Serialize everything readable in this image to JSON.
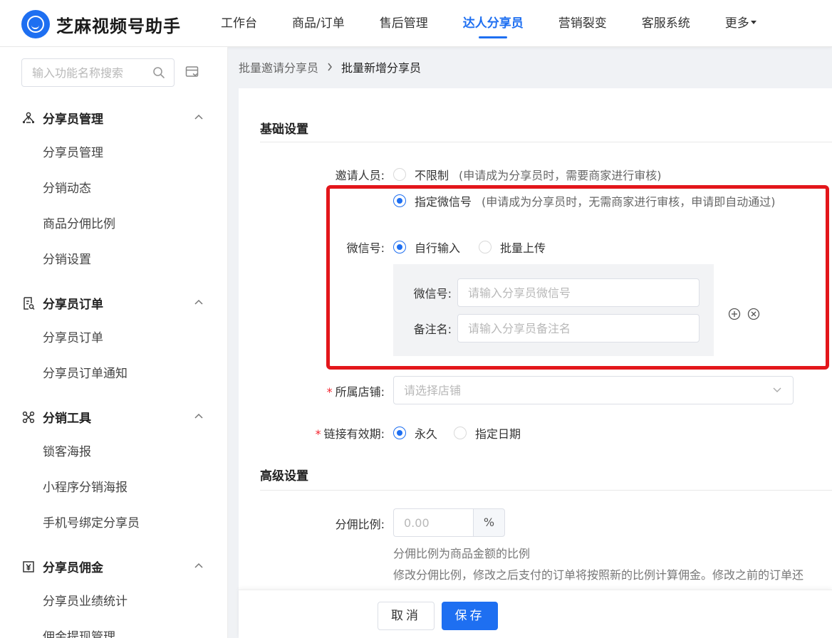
{
  "app": {
    "title": "芝麻视频号助手"
  },
  "nav": {
    "items": [
      {
        "label": "工作台",
        "active": false
      },
      {
        "label": "商品/订单",
        "active": false
      },
      {
        "label": "售后管理",
        "active": false
      },
      {
        "label": "达人分享员",
        "active": true
      },
      {
        "label": "营销裂变",
        "active": false
      },
      {
        "label": "客服系统",
        "active": false
      },
      {
        "label": "更多",
        "active": false
      }
    ]
  },
  "sidebar": {
    "search": {
      "placeholder": "输入功能名称搜索"
    },
    "groups": [
      {
        "title": "分享员管理",
        "icon": "user-network-icon",
        "items": [
          "分享员管理",
          "分销动态",
          "商品分佣比例",
          "分销设置"
        ]
      },
      {
        "title": "分享员订单",
        "icon": "order-doc-icon",
        "items": [
          "分享员订单",
          "分享员订单通知"
        ]
      },
      {
        "title": "分销工具",
        "icon": "distribution-tool-icon",
        "items": [
          "锁客海报",
          "小程序分销海报",
          "手机号绑定分享员"
        ]
      },
      {
        "title": "分享员佣金",
        "icon": "commission-icon",
        "items": [
          "分享员业绩统计",
          "佣金提现管理"
        ]
      }
    ]
  },
  "breadcrumb": {
    "parent": "批量邀请分享员",
    "current": "批量新增分享员"
  },
  "form": {
    "basic": {
      "title": "基础设置",
      "invite": {
        "label": "邀请人员:",
        "options": [
          {
            "label": "不限制",
            "hint": "(申请成为分享员时，需要商家进行审核)",
            "checked": false
          },
          {
            "label": "指定微信号",
            "hint": "(申请成为分享员时，无需商家进行审核，申请即自动通过)",
            "checked": true
          }
        ]
      },
      "wechat": {
        "label": "微信号:",
        "options": [
          {
            "label": "自行输入",
            "checked": true
          },
          {
            "label": "批量上传",
            "checked": false
          }
        ],
        "id_label": "微信号:",
        "id_placeholder": "请输入分享员微信号",
        "remark_label": "备注名:",
        "remark_placeholder": "请输入分享员备注名"
      },
      "store": {
        "label": "所属店铺:",
        "placeholder": "请选择店铺"
      },
      "validity": {
        "label": "链接有效期:",
        "options": [
          {
            "label": "永久",
            "checked": true
          },
          {
            "label": "指定日期",
            "checked": false
          }
        ]
      }
    },
    "advanced": {
      "title": "高级设置",
      "ratio": {
        "label": "分佣比例:",
        "placeholder": "0.00",
        "unit": "%",
        "note1": "分佣比例为商品金额的比例",
        "note2": "修改分佣比例，修改之后支付的订单将按照新的比例计算佣金。修改之前的订单还"
      }
    }
  },
  "footer": {
    "cancel_label": "取消",
    "save_label": "保存"
  },
  "colors": {
    "primary": "#1e6ff1",
    "highlight_frame": "#e3161b",
    "required": "#f5222d"
  }
}
